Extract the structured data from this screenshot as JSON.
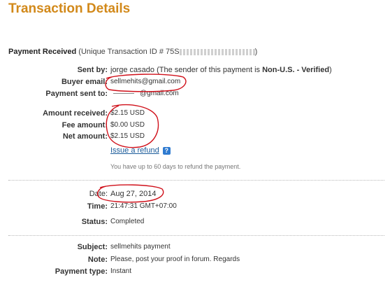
{
  "page": {
    "title": "Transaction Details"
  },
  "payment_received": {
    "label": "Payment Received",
    "id_prefix": "(Unique Transaction ID # 75S",
    "id_suffix": ")"
  },
  "sender": {
    "sent_by_label": "Sent by:",
    "sent_by_name": "jorge casado",
    "sent_by_note_prefix": "(The sender of this payment is ",
    "sent_by_status": "Non-U.S. - Verified",
    "sent_by_note_suffix": ")",
    "buyer_email_label": "Buyer email:",
    "buyer_email": "sellmehits@gmail.com",
    "payment_sent_to_label": "Payment sent to:",
    "payment_sent_to": "@gmail.com"
  },
  "amounts": {
    "amount_received_label": "Amount received:",
    "amount_received": "$2.15 USD",
    "fee_amount_label": "Fee amount:",
    "fee_amount": "$0.00 USD",
    "net_amount_label": "Net amount:",
    "net_amount": "$2.15 USD",
    "refund_link": "Issue a refund",
    "refund_note": "You have up to 60 days to refund the payment."
  },
  "details": {
    "date_label": "Date:",
    "date": "Aug 27, 2014",
    "time_label": "Time:",
    "time": "21:47:31 GMT+07:00",
    "status_label": "Status:",
    "status": "Completed"
  },
  "message": {
    "subject_label": "Subject:",
    "subject": "sellmehits payment",
    "note_label": "Note:",
    "note": "Please, post your proof in forum. Regards",
    "payment_type_label": "Payment type:",
    "payment_type": "Instant"
  },
  "icons": {
    "help": "help-question-icon"
  },
  "colors": {
    "title": "#d2891a",
    "link": "#1a5b9a",
    "annotation": "#d0101a",
    "help_icon": "#2f7bd0"
  }
}
